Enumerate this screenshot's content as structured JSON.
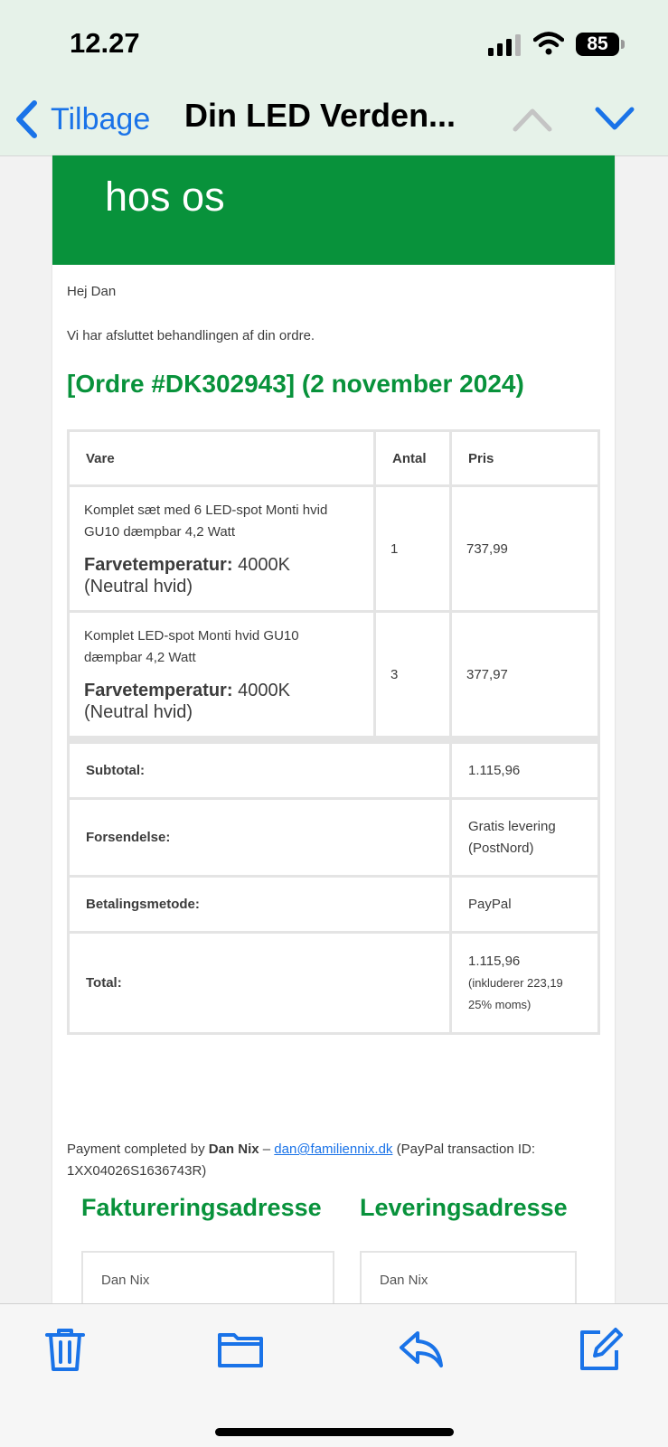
{
  "status_bar": {
    "time": "12.27",
    "battery": "85"
  },
  "nav": {
    "back_label": "Tilbage",
    "title": "Din LED Verden..."
  },
  "email": {
    "banner_text": "hos os",
    "greeting": "Hej Dan",
    "intro": "Vi har afsluttet behandlingen af din ordre.",
    "order_heading": "[Ordre #DK302943] (2 november 2024)",
    "table_headers": {
      "product": "Vare",
      "qty": "Antal",
      "price": "Pris"
    },
    "items": [
      {
        "name": "Komplet sæt med 6 LED-spot Monti hvid GU10 dæmpbar 4,2 Watt",
        "spec_label": "Farvetemperatur:",
        "spec_value": "4000K (Neutral hvid)",
        "qty": "1",
        "price": "737,99"
      },
      {
        "name": "Komplet LED-spot Monti hvid GU10 dæmpbar 4,2 Watt",
        "spec_label": "Farvetemperatur:",
        "spec_value": "4000K (Neutral hvid)",
        "qty": "3",
        "price": "377,97"
      }
    ],
    "totals": {
      "subtotal_label": "Subtotal:",
      "subtotal_value": "1.115,96",
      "shipping_label": "Forsendelse:",
      "shipping_value": "Gratis levering (PostNord)",
      "payment_label": "Betalingsmetode:",
      "payment_value": "PayPal",
      "total_label": "Total:",
      "total_value": "1.115,96",
      "total_tax": "(inkluderer 223,19 25% moms)"
    },
    "payment_line": {
      "prefix": "Payment completed by ",
      "name": "Dan Nix",
      "dash": " – ",
      "email": "dan@familiennix.dk",
      "suffix": " (PayPal transaction ID: 1XX04026S1636743R)"
    },
    "billing_heading": "Faktureringsadresse",
    "shipping_heading": "Leveringsadresse",
    "billing_name": "Dan Nix",
    "shipping_name": "Dan Nix"
  },
  "colors": {
    "brand_green": "#08923b",
    "link_blue": "#1a73e8",
    "nav_bg": "#e6f2e9"
  },
  "toolbar": {
    "icons": [
      "trash-icon",
      "folder-icon",
      "reply-icon",
      "compose-icon"
    ]
  }
}
